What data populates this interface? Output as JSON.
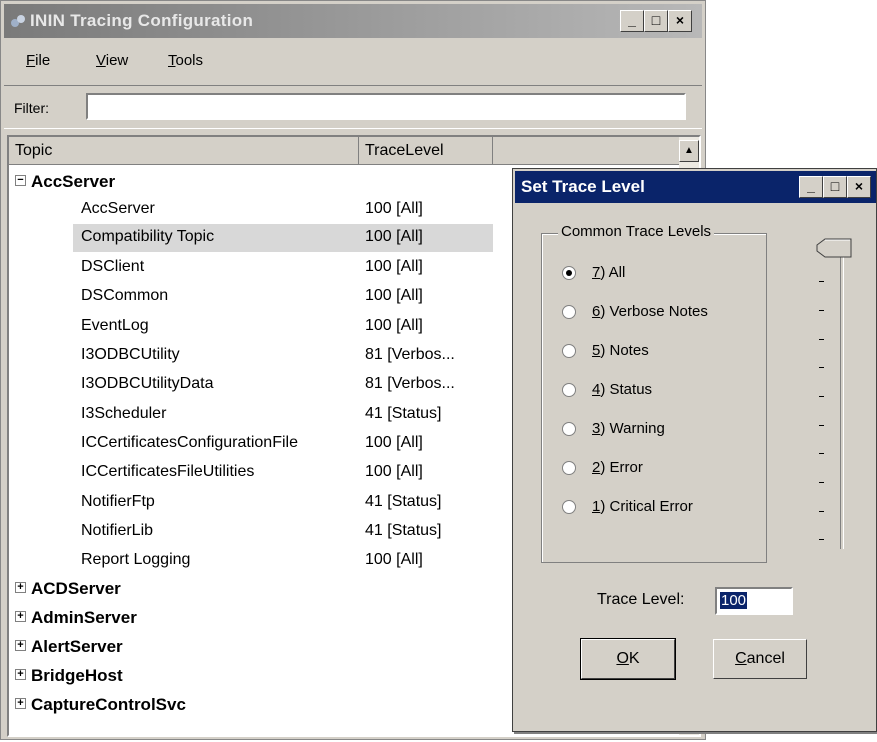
{
  "window": {
    "title": "ININ Tracing Configuration",
    "min_glyph": "_",
    "max_glyph": "□",
    "close_glyph": "×"
  },
  "menu": {
    "items": [
      {
        "label_ul": "F",
        "label_rest": "ile"
      },
      {
        "label_ul": "V",
        "label_rest": "iew"
      },
      {
        "label_ul": "T",
        "label_rest": "ools"
      }
    ]
  },
  "filter": {
    "label": "Filter:",
    "value": ""
  },
  "columns": {
    "topic": "Topic",
    "trace_level": "TraceLevel"
  },
  "tree": {
    "groups_expanded": [
      {
        "name": "AccServer",
        "expander": "−"
      }
    ],
    "children": [
      {
        "topic": "AccServer",
        "level": "100 [All]"
      },
      {
        "topic": "Compatibility Topic",
        "level": "100 [All]"
      },
      {
        "topic": "DSClient",
        "level": "100 [All]"
      },
      {
        "topic": "DSCommon",
        "level": "100 [All]"
      },
      {
        "topic": "EventLog",
        "level": "100 [All]"
      },
      {
        "topic": "I3ODBCUtility",
        "level": "81 [Verbos..."
      },
      {
        "topic": "I3ODBCUtilityData",
        "level": "81 [Verbos..."
      },
      {
        "topic": "I3Scheduler",
        "level": "41 [Status]"
      },
      {
        "topic": "ICCertificatesConfigurationFile",
        "level": "100 [All]"
      },
      {
        "topic": "ICCertificatesFileUtilities",
        "level": "100 [All]"
      },
      {
        "topic": "NotifierFtp",
        "level": "41 [Status]"
      },
      {
        "topic": "NotifierLib",
        "level": "41 [Status]"
      },
      {
        "topic": "Report Logging",
        "level": "100 [All]"
      }
    ],
    "collapsed_groups": [
      {
        "name": "ACDServer",
        "expander": "+"
      },
      {
        "name": "AdminServer",
        "expander": "+"
      },
      {
        "name": "AlertServer",
        "expander": "+"
      },
      {
        "name": "BridgeHost",
        "expander": "+"
      },
      {
        "name": "CaptureControlSvc",
        "expander": "+"
      }
    ],
    "selected_topic": "Compatibility Topic"
  },
  "dialog": {
    "title": "Set Trace Level",
    "group_label": "Common Trace Levels",
    "options": [
      {
        "ul": "7",
        "rest": ") All",
        "selected": true
      },
      {
        "ul": "6",
        "rest": ") Verbose Notes",
        "selected": false
      },
      {
        "ul": "5",
        "rest": ") Notes",
        "selected": false
      },
      {
        "ul": "4",
        "rest": ") Status",
        "selected": false
      },
      {
        "ul": "3",
        "rest": ") Warning",
        "selected": false
      },
      {
        "ul": "2",
        "rest": ") Error",
        "selected": false
      },
      {
        "ul": "1",
        "rest": ") Critical Error",
        "selected": false
      }
    ],
    "slider_level_fraction": 1.0,
    "trace_level_label": "Trace Level:",
    "trace_level_value": "100",
    "ok": {
      "ul": "O",
      "rest": "K"
    },
    "cancel": {
      "ul": "C",
      "rest": "ancel"
    }
  },
  "colors": {
    "dialog_title": "#0a246a",
    "selection_bg": "#d8d8d8",
    "window_face": "#d4d0c8"
  },
  "icons": [
    "app-icon",
    "minimize-icon",
    "maximize-icon",
    "close-icon",
    "scroll-up-icon",
    "scroll-down-icon",
    "collapse-icon",
    "expand-icon"
  ]
}
